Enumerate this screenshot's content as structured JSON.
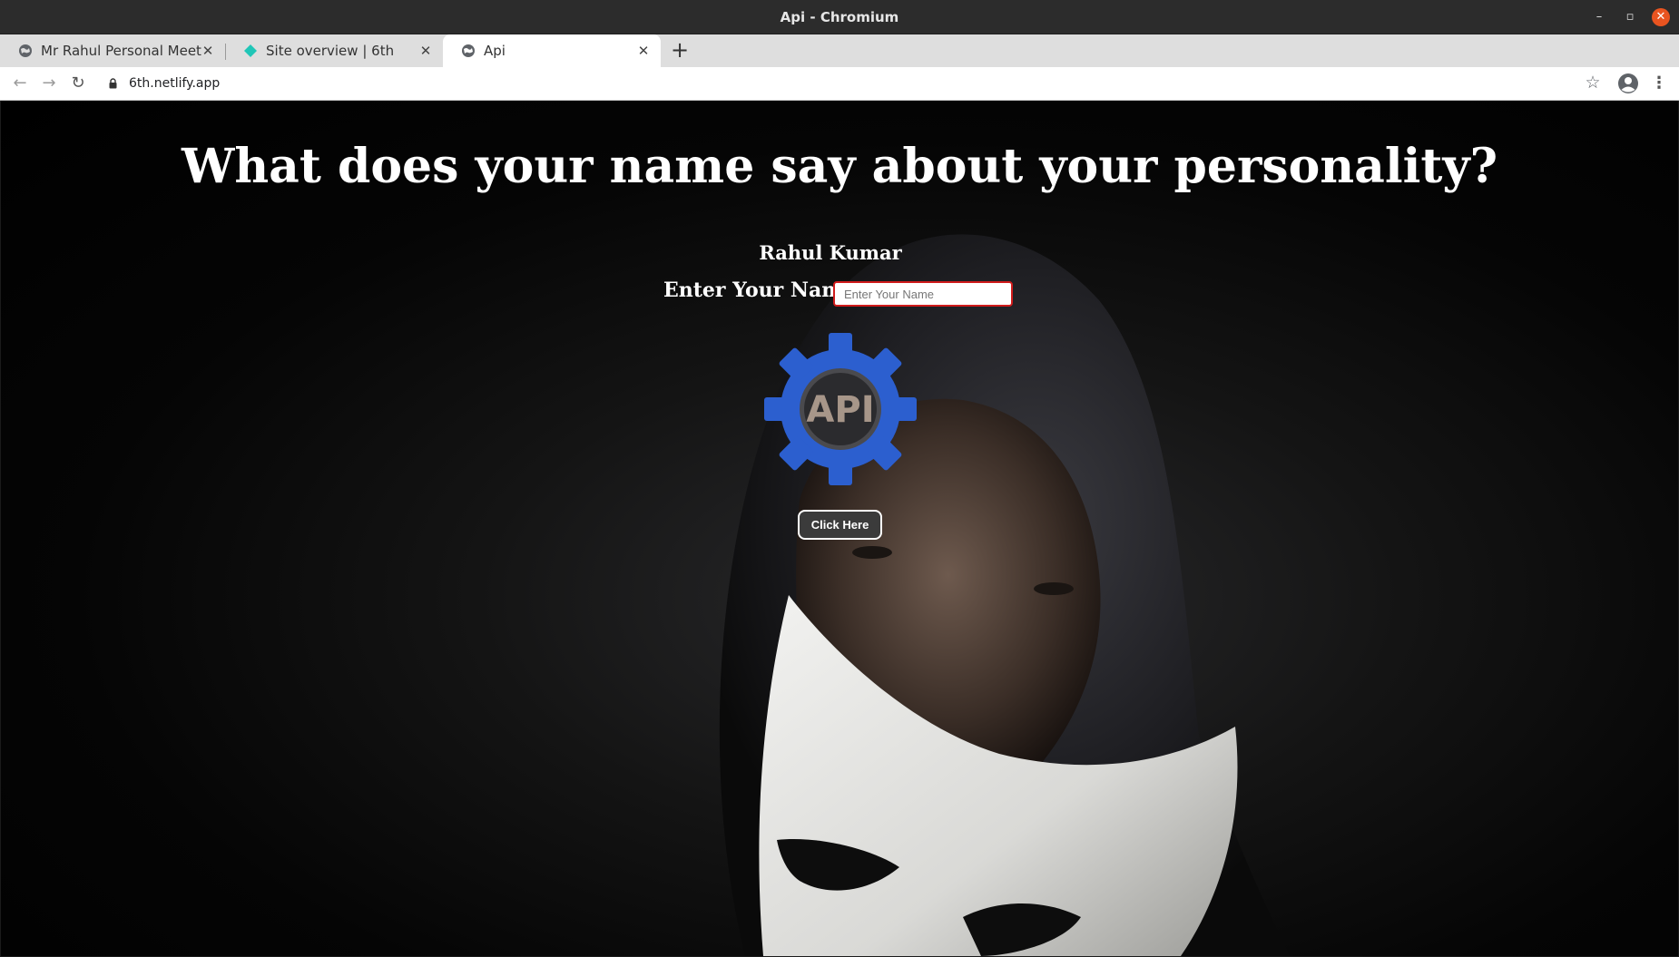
{
  "window": {
    "title": "Api - Chromium",
    "controls": {
      "minimize": "–",
      "maximize": "▫",
      "close": "✕"
    }
  },
  "tabs": [
    {
      "label": "Mr Rahul Personal Meet",
      "icon": "globe-icon",
      "active": false
    },
    {
      "label": "Site overview | 6th",
      "icon": "netlify-icon",
      "active": false
    },
    {
      "label": "Api",
      "icon": "globe-icon",
      "active": true
    }
  ],
  "toolbar": {
    "url": "6th.netlify.app",
    "back_icon": "back-arrow-icon",
    "forward_icon": "forward-arrow-icon",
    "reload_icon": "reload-icon",
    "bookmark_icon": "star-icon",
    "profile_icon": "profile-icon",
    "menu_icon": "kebab-menu-icon"
  },
  "page": {
    "heading": "What does your name say about your personality?",
    "result_name": "Rahul Kumar",
    "input_label": "Enter Your Name",
    "input_placeholder": "Enter Your Name",
    "input_value": "",
    "logo_text": "API",
    "button_label": "Click Here"
  },
  "colors": {
    "logo_gear": "#2c5fcf",
    "input_border": "#d01b1b",
    "button_bg": "#3b3b3b",
    "close_button": "#e95420",
    "netlify_teal": "#20c6b7"
  }
}
